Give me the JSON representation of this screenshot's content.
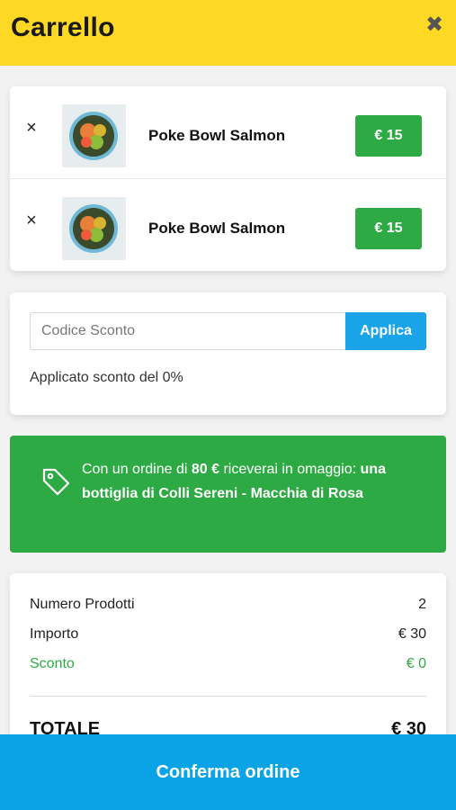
{
  "header": {
    "title": "Carrello",
    "close_icon": "close-icon",
    "background": "#fdd825"
  },
  "cart": {
    "items": [
      {
        "name": "Poke Bowl Salmon",
        "price": "€ 15",
        "remove_symbol": "×",
        "image": "poke-bowl-thumbnail"
      },
      {
        "name": "Poke Bowl Salmon",
        "price": "€ 15",
        "remove_symbol": "×",
        "image": "poke-bowl-thumbnail"
      }
    ]
  },
  "discount": {
    "placeholder": "Codice Sconto",
    "value": "",
    "apply_label": "Applica",
    "status_prefix": "Applicato sconto del ",
    "status_value": "0%"
  },
  "promo": {
    "icon": "tag-icon",
    "text_prefix": "Con un ordine di ",
    "threshold": "80 €",
    "text_middle": " riceverai in omaggio: ",
    "gift": "una bottiglia di Colli Sereni - Macchia di Rosa"
  },
  "summary": {
    "products_label": "Numero Prodotti",
    "products_value": "2",
    "amount_label": "Importo",
    "amount_value": "€ 30",
    "discount_label": "Sconto",
    "discount_value": "€ 0",
    "total_label": "TOTALE",
    "total_value": "€ 30"
  },
  "confirm": {
    "label": "Conferma ordine"
  },
  "colors": {
    "accent_yellow": "#fdd825",
    "green": "#2eaa44",
    "blue": "#0aa3e6"
  }
}
